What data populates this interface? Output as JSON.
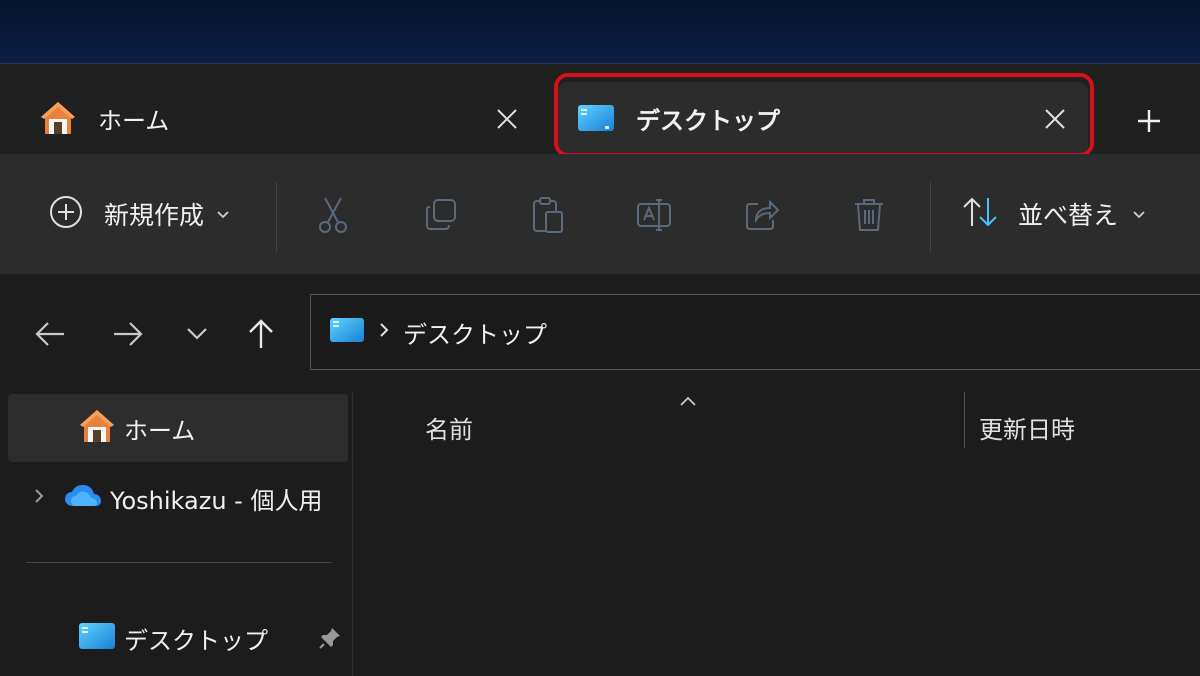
{
  "tabs": [
    {
      "label": "ホーム",
      "icon": "home-icon"
    },
    {
      "label": "デスクトップ",
      "icon": "desktop-folder-icon",
      "active": true
    }
  ],
  "colors": {
    "highlight": "#d4101a",
    "accent": "#4cc2ff",
    "window_bg": "#1c1c1c"
  },
  "toolbar": {
    "new_label": "新規作成",
    "sort_label": "並べ替え",
    "icons": [
      "cut-icon",
      "copy-icon",
      "paste-icon",
      "rename-icon",
      "share-icon",
      "delete-icon"
    ]
  },
  "address": {
    "crumb": "デスクトップ"
  },
  "sidebar": {
    "items": [
      {
        "label": "ホーム",
        "icon": "home-icon"
      },
      {
        "label": "Yoshikazu - 個人用",
        "icon": "onedrive-cloud-icon"
      },
      {
        "label": "デスクトップ",
        "icon": "desktop-folder-icon",
        "pinned": true
      }
    ]
  },
  "columns": {
    "name": "名前",
    "modified": "更新日時"
  }
}
